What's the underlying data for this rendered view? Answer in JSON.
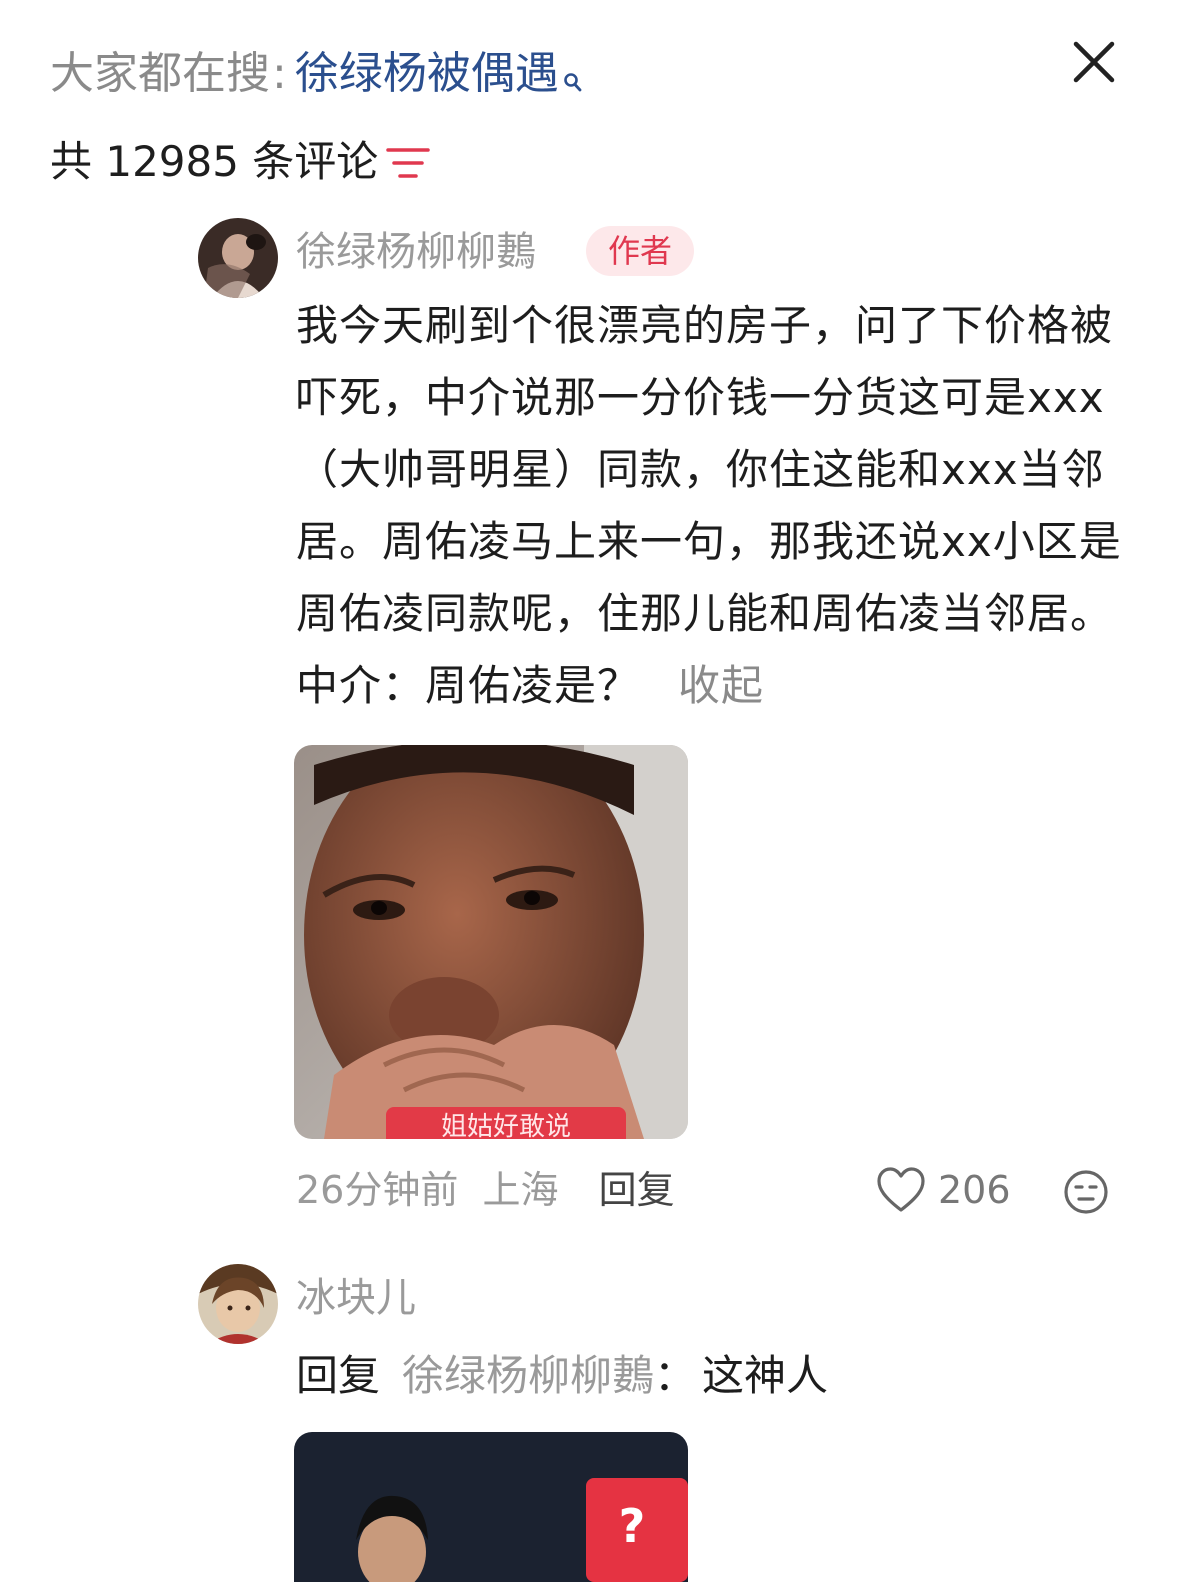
{
  "header": {
    "search_prefix": "大家都在搜",
    "search_colon": ":",
    "search_term": "徐绿杨被偶遇",
    "comment_count_text": "共 12985 条评论"
  },
  "comments": [
    {
      "username": "徐绿杨柳柳鶈",
      "badge": "作者",
      "text": "我今天刷到个很漂亮的房子，问了下价格被吓死，中介说那一分价钱一分货这可是xxx（大帅哥明星）同款，你住这能和xxx当邻居。周佑凌马上来一句，那我还说xx小区是周佑凌同款呢，住那儿能和周佑凌当邻居。中介：周佑凌是？",
      "collapse_label": "收起",
      "media_caption": "姐姑好敢说",
      "time": "26分钟前",
      "location": "上海",
      "reply_label": "回复",
      "likes": "206"
    },
    {
      "username": "冰块儿",
      "reply_prefix": "回复",
      "reply_to": "徐绿杨柳柳鶈",
      "reply_colon": "：",
      "text": "这神人",
      "media_badge": "?"
    }
  ],
  "colors": {
    "search_term": "#2b4f8e",
    "author_badge_bg": "#fde8ea",
    "author_badge_text": "#e0384f",
    "filter_icon": "#e0384f",
    "muted_text": "#9a9a9a"
  },
  "icons": [
    "search-icon",
    "close-icon",
    "filter-icon",
    "heart-icon",
    "dislike-face-icon"
  ]
}
